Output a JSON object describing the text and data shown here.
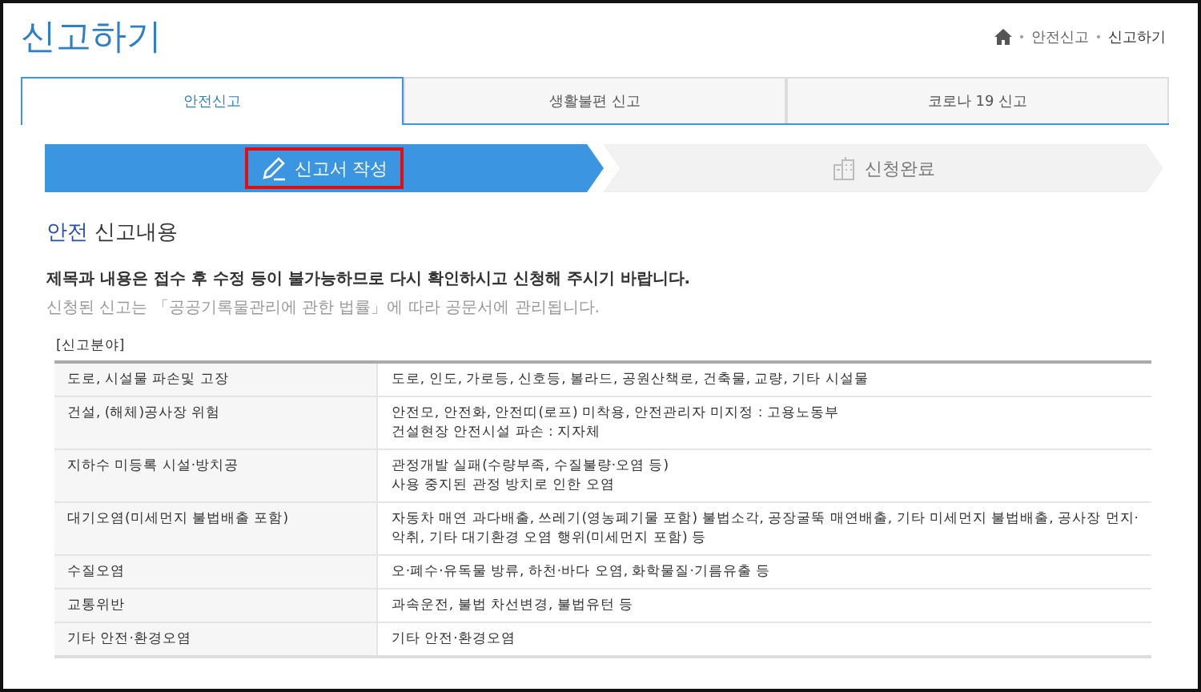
{
  "page_title": "신고하기",
  "breadcrumb": [
    "안전신고",
    "신고하기"
  ],
  "tabs": [
    {
      "label": "안전신고",
      "selected": true
    },
    {
      "label": "생활불편 신고",
      "selected": false
    },
    {
      "label": "코로나 19 신고",
      "selected": false
    }
  ],
  "steps": [
    {
      "label": "신고서 작성",
      "kind": "write",
      "selected": true,
      "highlighted": true
    },
    {
      "label": "신청완료",
      "kind": "done",
      "selected": false,
      "highlighted": false
    }
  ],
  "section_title": {
    "highlight": "안전",
    "rest": "신고내용"
  },
  "notice": "제목과 내용은 접수 후 수정 등이 불가능하므로 다시 확인하시고 신청해 주시기 바랍니다.",
  "notice_sub": "신청된 신고는 「공공기록물관리에 관한 법률」에 따라 공문서에 관리됩니다.",
  "table_caption": "[신고분야]",
  "table": {
    "rows": [
      {
        "field": "도로, 시설물 파손및 고장",
        "examples": [
          "도로, 인도, 가로등, 신호등, 볼라드, 공원산책로, 건축물, 교량, 기타 시설물"
        ]
      },
      {
        "field": "건설, (해체)공사장 위험",
        "examples": [
          "안전모, 안전화, 안전띠(로프) 미착용, 안전관리자 미지정 : 고용노동부",
          "건설현장 안전시설 파손 : 지자체"
        ]
      },
      {
        "field": "지하수 미등록 시설·방치공",
        "examples": [
          "관정개발 실패(수량부족, 수질불량·오염 등)",
          "사용 중지된 관정 방치로 인한 오염"
        ]
      },
      {
        "field": "대기오염(미세먼지 불법배출 포함)",
        "examples": [
          "자동차 매연 과다배출, 쓰레기(영농폐기물 포함) 불법소각, 공장굴뚝 매연배출, 기타 미세먼지 불법배출, 공사장 먼지·",
          "악취, 기타 대기환경 오염 행위(미세먼지 포함) 등"
        ]
      },
      {
        "field": "수질오염",
        "examples": [
          "오·폐수·유독물 방류, 하천·바다 오염, 화학물질·기름유출 등"
        ]
      },
      {
        "field": "교통위반",
        "examples": [
          "과속운전, 불법 차선변경, 불법유턴 등"
        ]
      },
      {
        "field": "기타 안전·환경오염",
        "examples": [
          "기타 안전·환경오염"
        ]
      }
    ]
  }
}
